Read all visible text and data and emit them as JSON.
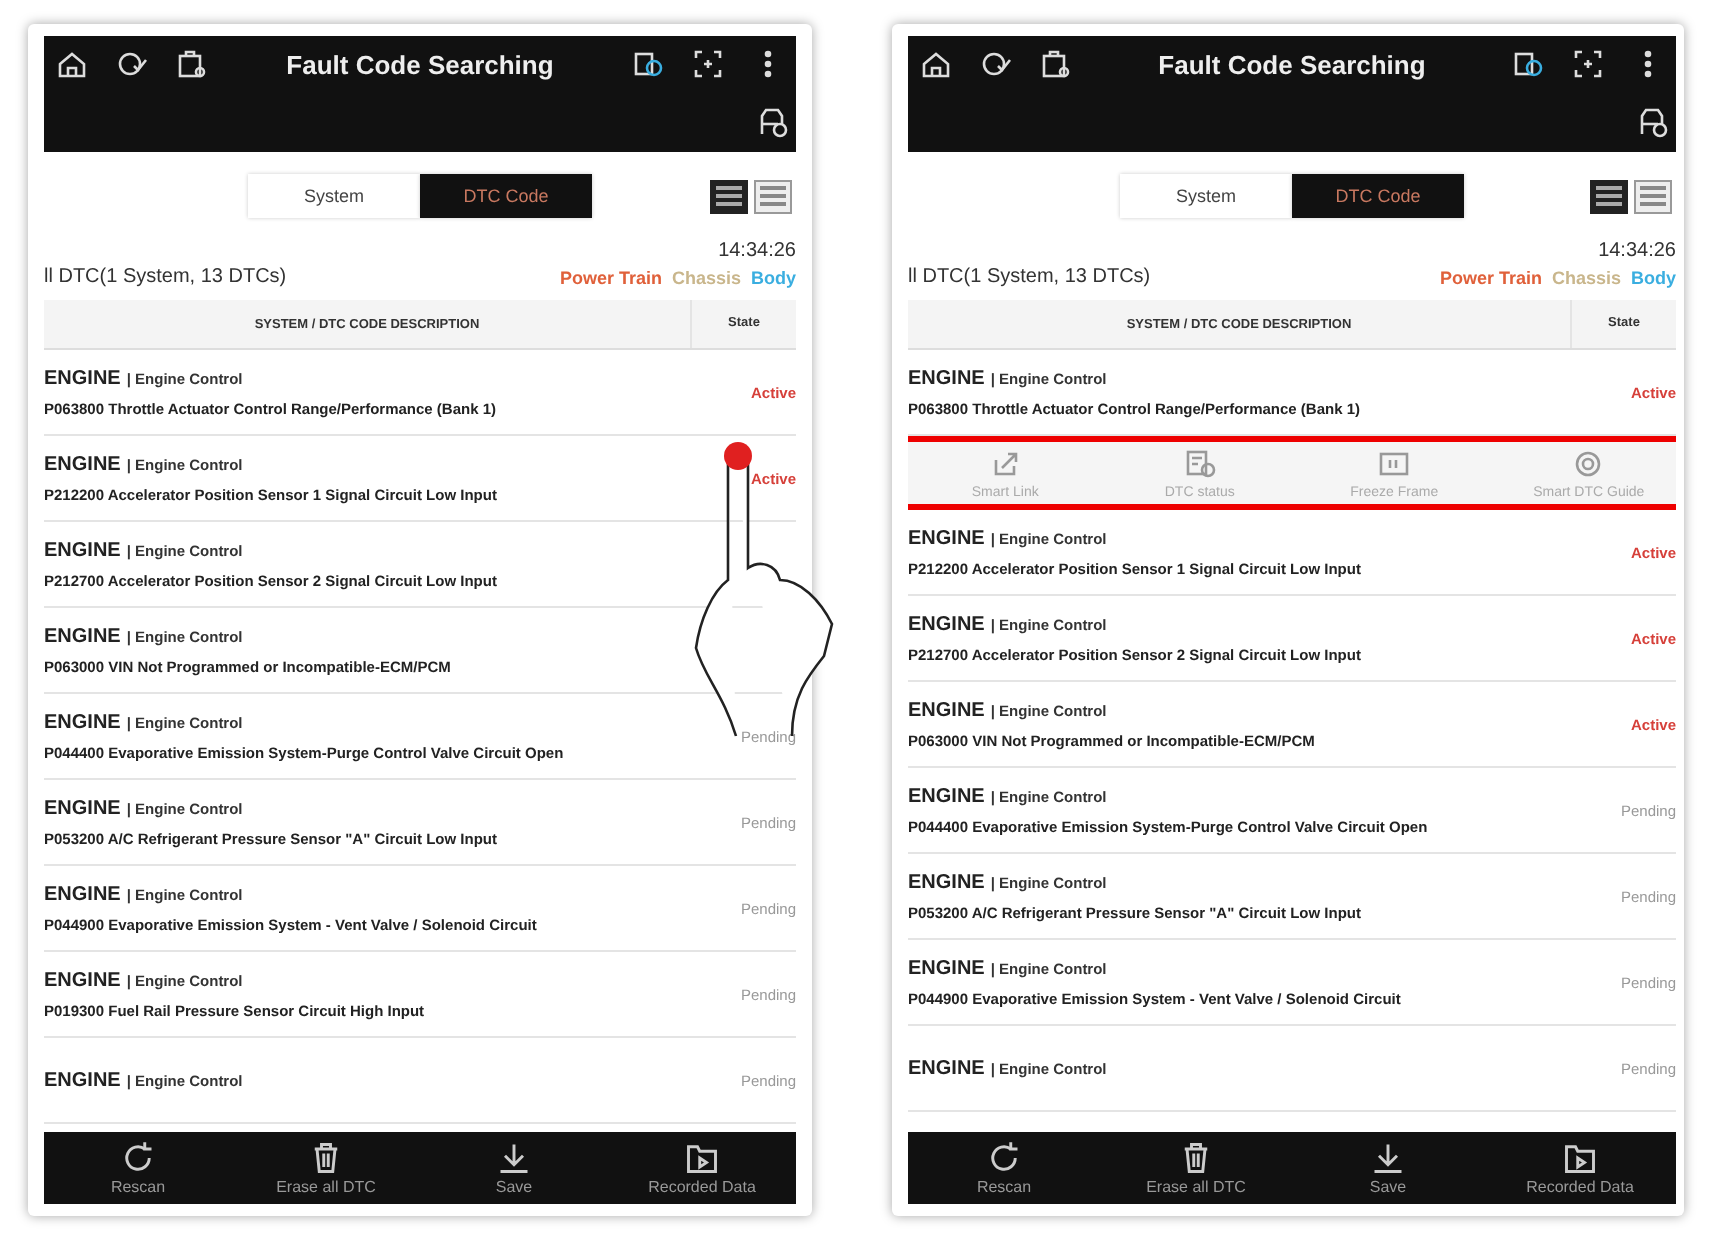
{
  "panels": [
    {
      "title": "Fault Code Searching",
      "touch_gesture": true,
      "tabs": [
        {
          "label": "System",
          "selected": false
        },
        {
          "label": "DTC Code",
          "selected": true
        }
      ],
      "view_modes": [
        {
          "selected": true
        },
        {
          "selected": false
        }
      ],
      "time": "14:34:26",
      "summary": "ll DTC(1 System, 13 DTCs)",
      "categories": [
        {
          "label": "Power Train",
          "color": "#e0603a"
        },
        {
          "label": "Chassis",
          "color": "#c9b68c"
        },
        {
          "label": "Body",
          "color": "#3aaee0"
        }
      ],
      "columns": [
        "SYSTEM / DTC CODE DESCRIPTION",
        "State"
      ],
      "rows": [
        {
          "kind": "dtc",
          "system": "ENGINE",
          "module": "| Engine Control",
          "description": "P063800 Throttle Actuator Control Range/Performance (Bank 1)",
          "state": "Active",
          "active": true
        },
        {
          "kind": "dtc",
          "system": "ENGINE",
          "module": "| Engine Control",
          "description": "P212200 Accelerator Position Sensor 1 Signal Circuit Low Input",
          "state": "Active",
          "active": true
        },
        {
          "kind": "dtc",
          "system": "ENGINE",
          "module": "| Engine Control",
          "description": "P212700 Accelerator Position Sensor 2 Signal Circuit Low Input"
        },
        {
          "kind": "dtc",
          "system": "ENGINE",
          "module": "| Engine Control",
          "description": "P063000 VIN Not Programmed or Incompatible-ECM/PCM"
        },
        {
          "kind": "dtc",
          "system": "ENGINE",
          "module": "| Engine Control",
          "description": "P044400 Evaporative Emission System-Purge Control Valve Circuit Open",
          "state": "Pending",
          "active": false
        },
        {
          "kind": "dtc",
          "system": "ENGINE",
          "module": "| Engine Control",
          "description": "P053200 A/C Refrigerant Pressure Sensor \"A\" Circuit Low Input",
          "state": "Pending",
          "active": false
        },
        {
          "kind": "dtc",
          "system": "ENGINE",
          "module": "| Engine Control",
          "description": "P044900 Evaporative Emission System - Vent Valve / Solenoid Circuit",
          "state": "Pending",
          "active": false
        },
        {
          "kind": "dtc",
          "system": "ENGINE",
          "module": "| Engine Control",
          "description": "P019300 Fuel Rail Pressure Sensor Circuit High Input",
          "state": "Pending",
          "active": false
        },
        {
          "kind": "dtc",
          "system": "ENGINE",
          "module": "| Engine Control",
          "state": "Pending",
          "active": false
        }
      ],
      "bottom_bar": [
        "Rescan",
        "Erase all DTC",
        "Save",
        "Recorded Data"
      ]
    },
    {
      "title": "Fault Code Searching",
      "tabs": [
        {
          "label": "System",
          "selected": false
        },
        {
          "label": "DTC Code",
          "selected": true
        }
      ],
      "view_modes": [
        {
          "selected": true
        },
        {
          "selected": false
        }
      ],
      "time": "14:34:26",
      "summary": "ll DTC(1 System, 13 DTCs)",
      "categories": [
        {
          "label": "Power Train",
          "color": "#e0603a"
        },
        {
          "label": "Chassis",
          "color": "#c9b68c"
        },
        {
          "label": "Body",
          "color": "#3aaee0"
        }
      ],
      "columns": [
        "SYSTEM / DTC CODE DESCRIPTION",
        "State"
      ],
      "rows": [
        {
          "kind": "dtc",
          "system": "ENGINE",
          "module": "| Engine Control",
          "description": "P063800 Throttle Actuator Control Range/Performance (Bank 1)",
          "state": "Active",
          "active": true
        },
        {
          "kind": "actions",
          "highlighted": true,
          "items": [
            "Smart Link",
            "DTC status",
            "Freeze Frame",
            "Smart DTC Guide"
          ]
        },
        {
          "kind": "dtc",
          "system": "ENGINE",
          "module": "| Engine Control",
          "description": "P212200 Accelerator Position Sensor 1 Signal Circuit Low Input",
          "state": "Active",
          "active": true
        },
        {
          "kind": "dtc",
          "system": "ENGINE",
          "module": "| Engine Control",
          "description": "P212700 Accelerator Position Sensor 2 Signal Circuit Low Input",
          "state": "Active",
          "active": true
        },
        {
          "kind": "dtc",
          "system": "ENGINE",
          "module": "| Engine Control",
          "description": "P063000 VIN Not Programmed or Incompatible-ECM/PCM",
          "state": "Active",
          "active": true
        },
        {
          "kind": "dtc",
          "system": "ENGINE",
          "module": "| Engine Control",
          "description": "P044400 Evaporative Emission System-Purge Control Valve Circuit Open",
          "state": "Pending",
          "active": false
        },
        {
          "kind": "dtc",
          "system": "ENGINE",
          "module": "| Engine Control",
          "description": "P053200 A/C Refrigerant Pressure Sensor \"A\" Circuit Low Input",
          "state": "Pending",
          "active": false
        },
        {
          "kind": "dtc",
          "system": "ENGINE",
          "module": "| Engine Control",
          "description": "P044900 Evaporative Emission System - Vent Valve / Solenoid Circuit",
          "state": "Pending",
          "active": false
        },
        {
          "kind": "dtc",
          "system": "ENGINE",
          "module": "| Engine Control",
          "state": "Pending",
          "active": false
        }
      ],
      "bottom_bar": [
        "Rescan",
        "Erase all DTC",
        "Save",
        "Recorded Data"
      ]
    }
  ]
}
